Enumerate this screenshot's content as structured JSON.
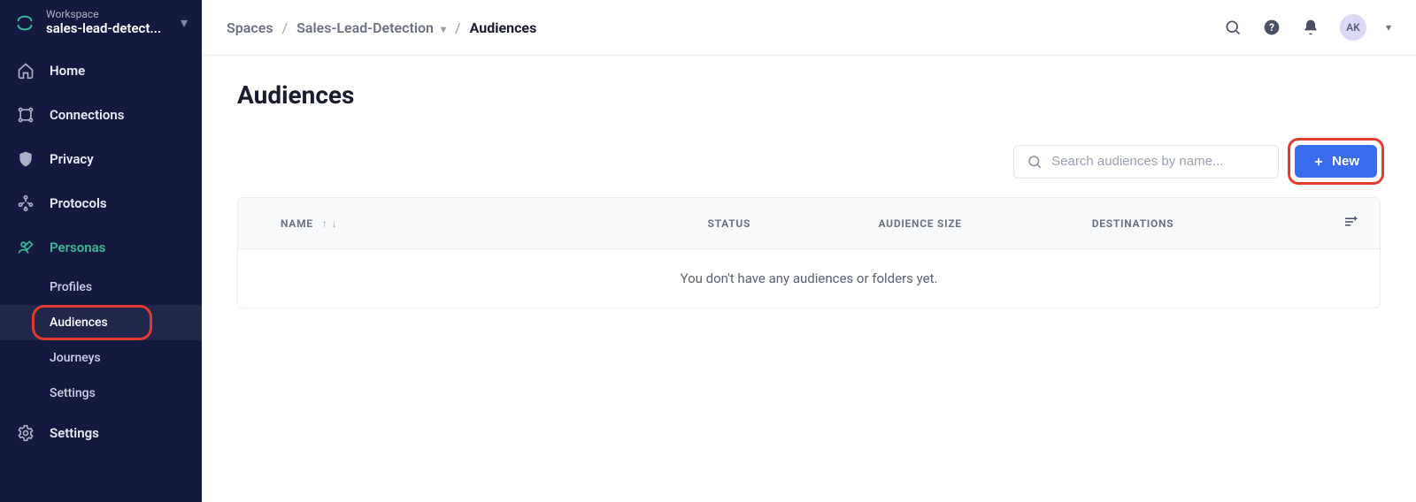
{
  "workspace": {
    "label": "Workspace",
    "name": "sales-lead-detect..."
  },
  "sidebar": {
    "home": "Home",
    "connections": "Connections",
    "privacy": "Privacy",
    "protocols": "Protocols",
    "personas": "Personas",
    "settings": "Settings",
    "sub": {
      "profiles": "Profiles",
      "audiences": "Audiences",
      "journeys": "Journeys",
      "settings": "Settings"
    }
  },
  "breadcrumbs": {
    "spaces": "Spaces",
    "space_name": "Sales-Lead-Detection",
    "current": "Audiences"
  },
  "user": {
    "initials": "AK"
  },
  "page": {
    "title": "Audiences",
    "search_placeholder": "Search audiences by name...",
    "new_button": "New",
    "empty": "You don't have any audiences or folders yet."
  },
  "table": {
    "name": "NAME",
    "status": "STATUS",
    "size": "AUDIENCE SIZE",
    "destinations": "DESTINATIONS"
  }
}
